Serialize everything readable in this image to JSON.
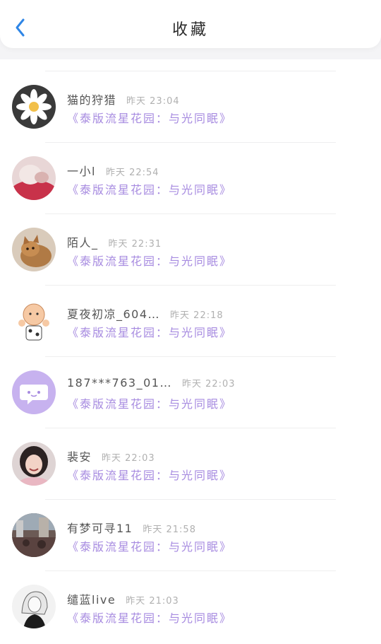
{
  "header": {
    "title": "收藏",
    "back_icon": "chevron-left-icon"
  },
  "colors": {
    "accent_blue": "#2f86e6",
    "link_purple": "#a78be0"
  },
  "items": [
    {
      "name": "猫的狩猎",
      "time": "昨天 23:04",
      "collection": "《泰版流星花园：与光同眠》",
      "avatar": "daisy-avatar"
    },
    {
      "name": "一小l",
      "time": "昨天 22:54",
      "collection": "《泰版流星花园：与光同眠》",
      "avatar": "photo-avatar"
    },
    {
      "name": "陌人_",
      "time": "昨天 22:31",
      "collection": "《泰版流星花园：与光同眠》",
      "avatar": "cat-avatar"
    },
    {
      "name": "夏夜初凉_604…",
      "time": "昨天 22:18",
      "collection": "《泰版流星花园：与光同眠》",
      "avatar": "cartoon-avatar"
    },
    {
      "name": "187***763_01…",
      "time": "昨天 22:03",
      "collection": "《泰版流星花园：与光同眠》",
      "avatar": "chat-bubble-avatar"
    },
    {
      "name": "裴安",
      "time": "昨天 22:03",
      "collection": "《泰版流星花园：与光同眠》",
      "avatar": "girl-avatar"
    },
    {
      "name": "有梦可寻11",
      "time": "昨天 21:58",
      "collection": "《泰版流星花园：与光同眠》",
      "avatar": "street-avatar"
    },
    {
      "name": "缱蓝live",
      "time": "昨天 21:03",
      "collection": "《泰版流星花园：与光同眠》",
      "avatar": "sketch-avatar"
    }
  ]
}
